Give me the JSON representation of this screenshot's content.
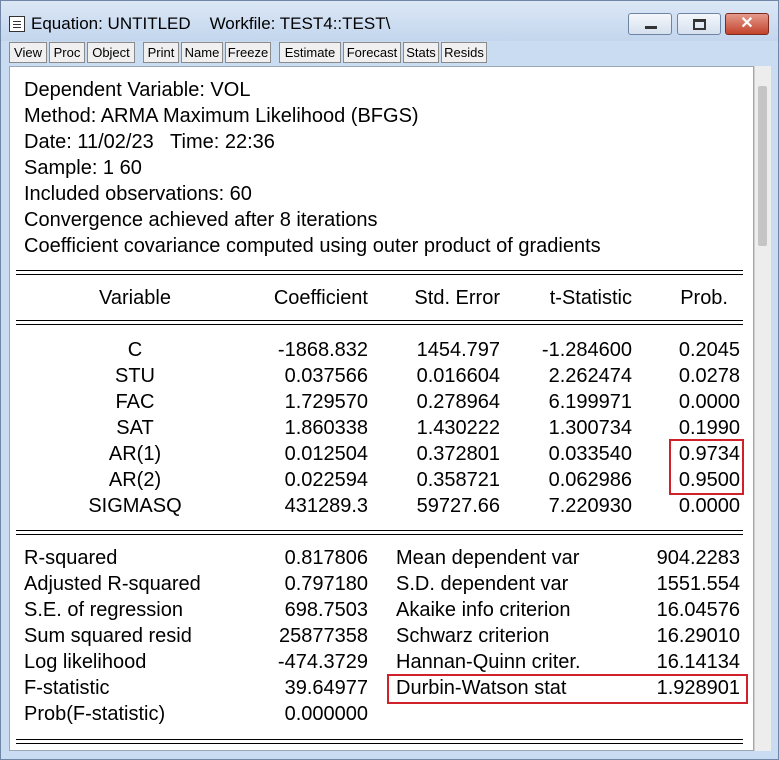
{
  "window": {
    "title": "Equation: UNTITLED    Workfile: TEST4::TEST\\",
    "toolbar": [
      "View",
      "Proc",
      "Object",
      "Print",
      "Name",
      "Freeze",
      "Estimate",
      "Forecast",
      "Stats",
      "Resids"
    ]
  },
  "header": {
    "lines": [
      "Dependent Variable: VOL",
      "Method: ARMA Maximum Likelihood (BFGS)",
      "Date: 11/02/23   Time: 22:36",
      "Sample: 1 60",
      "Included observations: 60",
      "Convergence achieved after 8 iterations",
      "Coefficient covariance computed using outer product of gradients"
    ]
  },
  "table": {
    "columns": [
      "Variable",
      "Coefficient",
      "Std. Error",
      "t-Statistic",
      "Prob."
    ],
    "rows": [
      [
        "C",
        "-1868.832",
        "1454.797",
        "-1.284600",
        "0.2045"
      ],
      [
        "STU",
        "0.037566",
        "0.016604",
        "2.262474",
        "0.0278"
      ],
      [
        "FAC",
        "1.729570",
        "0.278964",
        "6.199971",
        "0.0000"
      ],
      [
        "SAT",
        "1.860338",
        "1.430222",
        "1.300734",
        "0.1990"
      ],
      [
        "AR(1)",
        "0.012504",
        "0.372801",
        "0.033540",
        "0.9734"
      ],
      [
        "AR(2)",
        "0.022594",
        "0.358721",
        "0.062986",
        "0.9500"
      ],
      [
        "SIGMASQ",
        "431289.3",
        "59727.66",
        "7.220930",
        "0.0000"
      ]
    ]
  },
  "stats": {
    "left": [
      [
        "R-squared",
        "0.817806"
      ],
      [
        "Adjusted R-squared",
        "0.797180"
      ],
      [
        "S.E. of regression",
        "698.7503"
      ],
      [
        "Sum squared resid",
        "25877358"
      ],
      [
        "Log likelihood",
        "-474.3729"
      ],
      [
        "F-statistic",
        "39.64977"
      ],
      [
        "Prob(F-statistic)",
        "0.000000"
      ]
    ],
    "right": [
      [
        "Mean dependent var",
        "904.2283"
      ],
      [
        "S.D. dependent var",
        "1551.554"
      ],
      [
        "Akaike info criterion",
        "16.04576"
      ],
      [
        "Schwarz criterion",
        "16.29010"
      ],
      [
        "Hannan-Quinn criter.",
        "16.14134"
      ],
      [
        "Durbin-Watson stat",
        "1.928901"
      ]
    ]
  },
  "highlight_color": "#d0202a"
}
